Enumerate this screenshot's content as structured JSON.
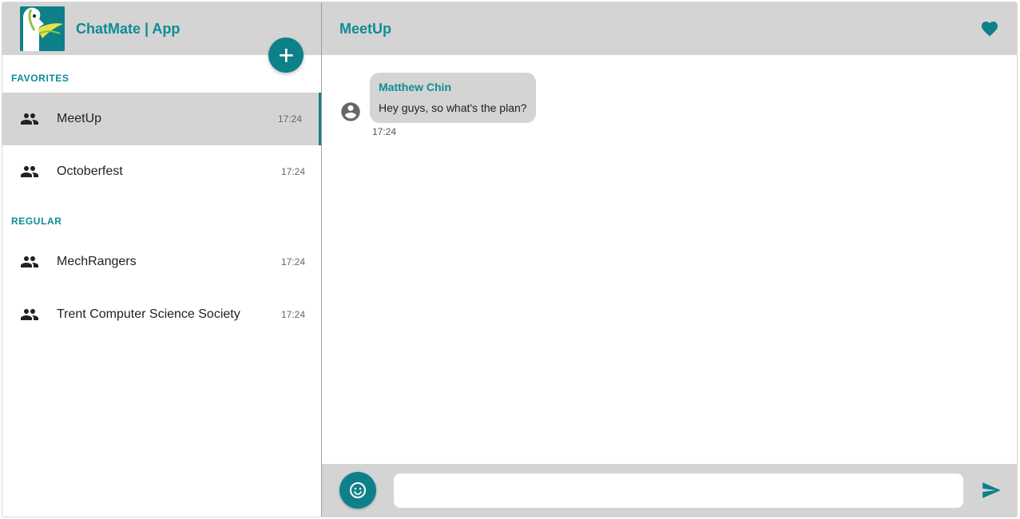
{
  "app": {
    "title": "ChatMate | App"
  },
  "sidebar": {
    "sections": [
      {
        "label": "FAVORITES",
        "items": [
          {
            "name": "MeetUp",
            "time": "17:24",
            "active": true
          },
          {
            "name": "Octoberfest",
            "time": "17:24",
            "active": false
          }
        ]
      },
      {
        "label": "REGULAR",
        "items": [
          {
            "name": "MechRangers",
            "time": "17:24",
            "active": false
          },
          {
            "name": "Trent Computer Science Society",
            "time": "17:24",
            "active": false
          }
        ]
      }
    ]
  },
  "conversation": {
    "title": "MeetUp",
    "messages": [
      {
        "sender": "Matthew Chin",
        "text": "Hey guys, so what's the plan?",
        "time": "17:24"
      }
    ]
  },
  "composer": {
    "value": "",
    "placeholder": ""
  },
  "colors": {
    "accent": "#0e8089",
    "accent_text": "#0e8c94",
    "panel": "#d4d4d4"
  },
  "icons": {
    "add": "plus-icon",
    "group": "group-icon",
    "favorite": "heart-icon",
    "avatar": "account-circle-icon",
    "emoji": "smiley-icon",
    "send": "send-icon"
  }
}
